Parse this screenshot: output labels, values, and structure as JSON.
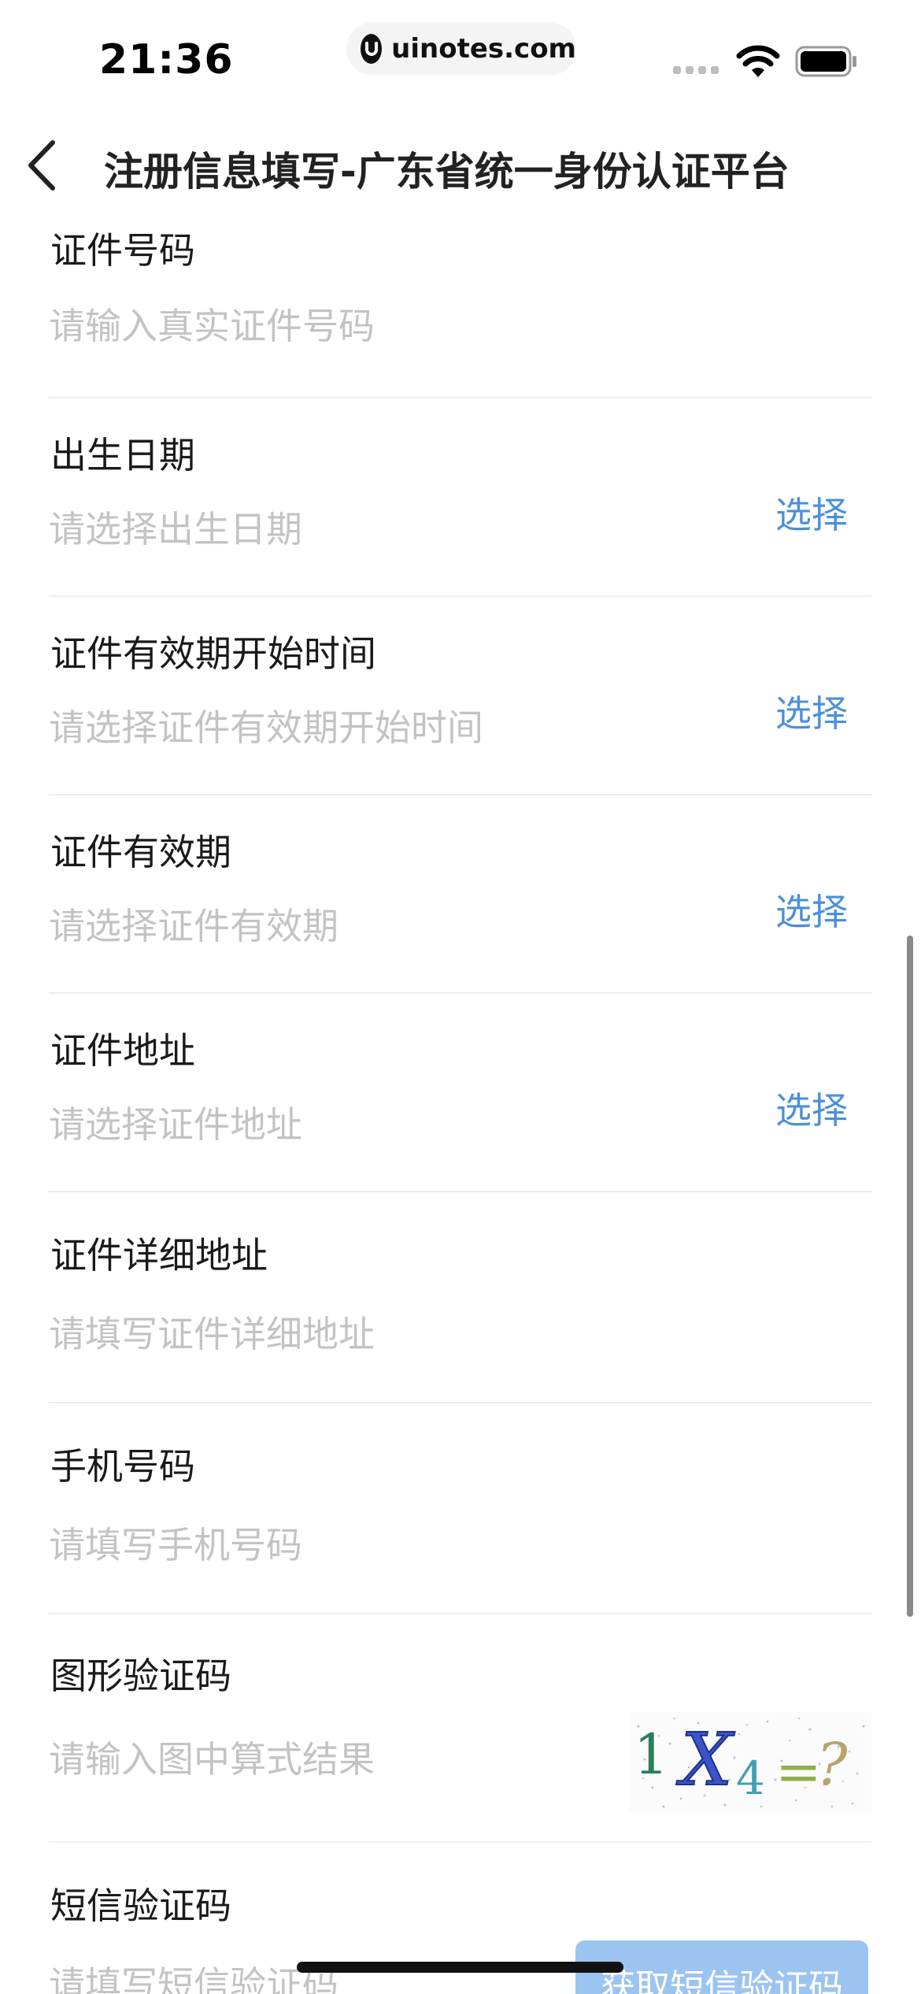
{
  "status_bar": {
    "time": "21:36",
    "url": "uinotes.com"
  },
  "nav": {
    "title": "注册信息填写-广东省统一身份认证平台"
  },
  "fields": [
    {
      "label": "证件号码",
      "placeholder": "请输入真实证件号码"
    },
    {
      "label": "出生日期",
      "placeholder": "请选择出生日期",
      "action": "选择"
    },
    {
      "label": "证件有效期开始时间",
      "placeholder": "请选择证件有效期开始时间",
      "action": "选择"
    },
    {
      "label": "证件有效期",
      "placeholder": "请选择证件有效期",
      "action": "选择"
    },
    {
      "label": "证件地址",
      "placeholder": "请选择证件地址",
      "action": "选择"
    },
    {
      "label": "证件详细地址",
      "placeholder": "请填写证件详细地址"
    },
    {
      "label": "手机号码",
      "placeholder": "请填写手机号码"
    },
    {
      "label": "图形验证码",
      "placeholder": "请输入图中算式结果"
    },
    {
      "label": "短信验证码",
      "placeholder": "请填写短信验证码",
      "action": "获取短信验证码"
    }
  ],
  "captcha": {
    "parts": [
      "1",
      "X",
      "4",
      "=",
      "?"
    ]
  },
  "colors": {
    "accent": "#4a90d9",
    "placeholder": "#c3c3c3",
    "label": "#1a1a1a",
    "sms_button": "#9cc4f0"
  }
}
